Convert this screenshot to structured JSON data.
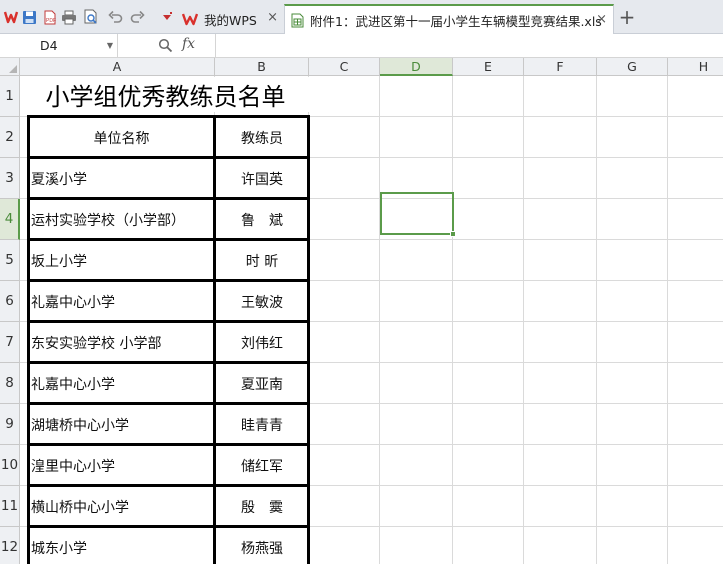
{
  "tabs": {
    "home_label": "我的WPS",
    "doc_label": "附件1：武进区第十一届小学生车辆模型竞赛结果.xls",
    "close_glyph": "×",
    "new_tab_glyph": "+"
  },
  "formula_bar": {
    "name_box": "D4",
    "fx_label": "fx",
    "formula_value": ""
  },
  "sheet": {
    "columns": [
      "A",
      "B",
      "C",
      "D",
      "E",
      "F",
      "G",
      "H"
    ],
    "rows": [
      "1",
      "2",
      "3",
      "4",
      "5",
      "6",
      "7",
      "8",
      "9",
      "10",
      "11",
      "12"
    ],
    "selected_cell": "D4",
    "title": "小学组优秀教练员名单",
    "header": {
      "school": "单位名称",
      "coach": "教练员"
    },
    "records": [
      {
        "school": "夏溪小学",
        "coach": "许国英"
      },
      {
        "school": "运村实验学校（小学部）",
        "coach": "鲁　斌"
      },
      {
        "school": "坂上小学",
        "coach": "时 昕"
      },
      {
        "school": "礼嘉中心小学",
        "coach": "王敏波"
      },
      {
        "school": "东安实验学校 小学部",
        "coach": "刘伟红"
      },
      {
        "school": "礼嘉中心小学",
        "coach": "夏亚南"
      },
      {
        "school": "湖塘桥中心小学",
        "coach": "眭青青"
      },
      {
        "school": "湟里中心小学",
        "coach": "储红军"
      },
      {
        "school": "横山桥中心小学",
        "coach": "殷　霙"
      },
      {
        "school": "城东小学",
        "coach": "杨燕强"
      }
    ]
  },
  "colors": {
    "accent": "#5b9b4a",
    "header_bg": "#eef0f3",
    "tabbar_bg": "#e6e9ee",
    "wps_red": "#d9312c"
  },
  "icons": [
    "wps-logo-icon",
    "save-icon",
    "export-pdf-icon",
    "print-icon",
    "print-preview-icon",
    "undo-icon",
    "redo-icon",
    "customize-toolbar-icon",
    "spreadsheet-doc-icon",
    "zoom-icon"
  ]
}
